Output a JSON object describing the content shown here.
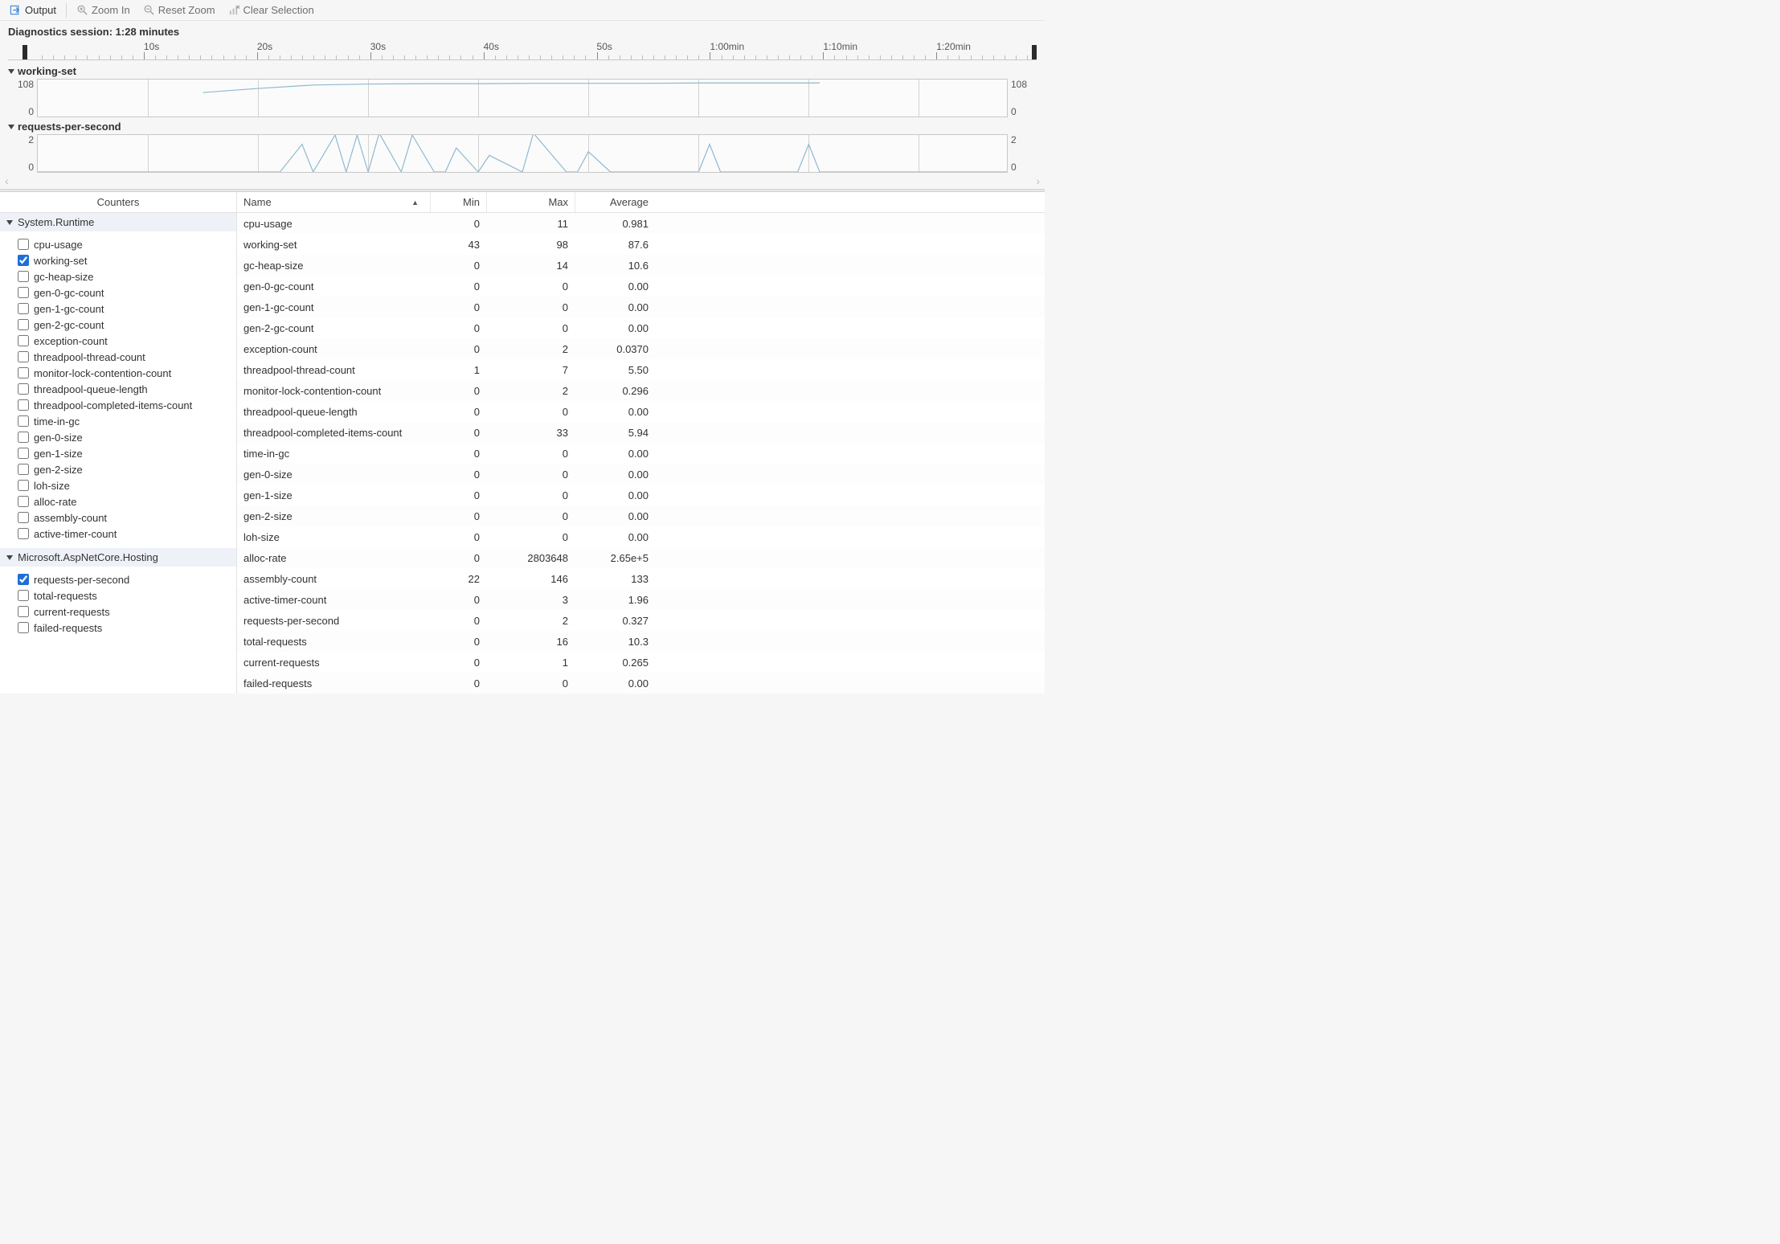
{
  "toolbar": {
    "output_label": "Output",
    "zoom_in_label": "Zoom In",
    "reset_zoom_label": "Reset Zoom",
    "clear_selection_label": "Clear Selection"
  },
  "session_label": "Diagnostics session: 1:28 minutes",
  "timeline": {
    "labels": [
      "10s",
      "20s",
      "30s",
      "40s",
      "50s",
      "1:00min",
      "1:10min",
      "1:20min"
    ]
  },
  "chart_data": [
    {
      "type": "line",
      "title": "working-set",
      "ylim": [
        0,
        108
      ],
      "yticks_left": [
        "108",
        "0"
      ],
      "yticks_right": [
        "108",
        "0"
      ],
      "x": [
        0,
        5,
        10,
        15,
        17,
        20,
        25,
        30,
        35,
        40,
        45,
        50,
        55,
        60,
        65,
        70,
        71
      ],
      "values": [
        null,
        null,
        null,
        70,
        75,
        82,
        92,
        95,
        96,
        96,
        97,
        97,
        97,
        98,
        98,
        98,
        98
      ]
    },
    {
      "type": "line",
      "title": "requests-per-second",
      "ylim": [
        0,
        2
      ],
      "yticks_left": [
        "2",
        "0"
      ],
      "yticks_right": [
        "2",
        "0"
      ],
      "x": [
        0,
        22,
        24,
        25,
        27,
        28,
        29,
        30,
        31,
        33,
        34,
        36,
        37,
        38,
        40,
        41,
        44,
        45,
        48,
        49,
        50,
        52,
        60,
        61,
        62,
        69,
        70,
        71,
        88
      ],
      "values": [
        0,
        0,
        1.5,
        0,
        2,
        0,
        2,
        0,
        2.1,
        0,
        2,
        0,
        0,
        1.3,
        0,
        0.9,
        0,
        2.1,
        0,
        0,
        1.1,
        0,
        0,
        1.5,
        0,
        0,
        1.5,
        0,
        0
      ]
    }
  ],
  "tree": {
    "header": "Counters",
    "groups": [
      {
        "label": "System.Runtime",
        "items": [
          {
            "label": "cpu-usage",
            "checked": false
          },
          {
            "label": "working-set",
            "checked": true
          },
          {
            "label": "gc-heap-size",
            "checked": false
          },
          {
            "label": "gen-0-gc-count",
            "checked": false
          },
          {
            "label": "gen-1-gc-count",
            "checked": false
          },
          {
            "label": "gen-2-gc-count",
            "checked": false
          },
          {
            "label": "exception-count",
            "checked": false
          },
          {
            "label": "threadpool-thread-count",
            "checked": false
          },
          {
            "label": "monitor-lock-contention-count",
            "checked": false
          },
          {
            "label": "threadpool-queue-length",
            "checked": false
          },
          {
            "label": "threadpool-completed-items-count",
            "checked": false
          },
          {
            "label": "time-in-gc",
            "checked": false
          },
          {
            "label": "gen-0-size",
            "checked": false
          },
          {
            "label": "gen-1-size",
            "checked": false
          },
          {
            "label": "gen-2-size",
            "checked": false
          },
          {
            "label": "loh-size",
            "checked": false
          },
          {
            "label": "alloc-rate",
            "checked": false
          },
          {
            "label": "assembly-count",
            "checked": false
          },
          {
            "label": "active-timer-count",
            "checked": false
          }
        ]
      },
      {
        "label": "Microsoft.AspNetCore.Hosting",
        "items": [
          {
            "label": "requests-per-second",
            "checked": true
          },
          {
            "label": "total-requests",
            "checked": false
          },
          {
            "label": "current-requests",
            "checked": false
          },
          {
            "label": "failed-requests",
            "checked": false
          }
        ]
      }
    ]
  },
  "table": {
    "headers": {
      "name": "Name",
      "min": "Min",
      "max": "Max",
      "avg": "Average"
    },
    "rows": [
      {
        "name": "cpu-usage",
        "min": "0",
        "max": "11",
        "avg": "0.981"
      },
      {
        "name": "working-set",
        "min": "43",
        "max": "98",
        "avg": "87.6"
      },
      {
        "name": "gc-heap-size",
        "min": "0",
        "max": "14",
        "avg": "10.6"
      },
      {
        "name": "gen-0-gc-count",
        "min": "0",
        "max": "0",
        "avg": "0.00"
      },
      {
        "name": "gen-1-gc-count",
        "min": "0",
        "max": "0",
        "avg": "0.00"
      },
      {
        "name": "gen-2-gc-count",
        "min": "0",
        "max": "0",
        "avg": "0.00"
      },
      {
        "name": "exception-count",
        "min": "0",
        "max": "2",
        "avg": "0.0370"
      },
      {
        "name": "threadpool-thread-count",
        "min": "1",
        "max": "7",
        "avg": "5.50"
      },
      {
        "name": "monitor-lock-contention-count",
        "min": "0",
        "max": "2",
        "avg": "0.296"
      },
      {
        "name": "threadpool-queue-length",
        "min": "0",
        "max": "0",
        "avg": "0.00"
      },
      {
        "name": "threadpool-completed-items-count",
        "min": "0",
        "max": "33",
        "avg": "5.94"
      },
      {
        "name": "time-in-gc",
        "min": "0",
        "max": "0",
        "avg": "0.00"
      },
      {
        "name": "gen-0-size",
        "min": "0",
        "max": "0",
        "avg": "0.00"
      },
      {
        "name": "gen-1-size",
        "min": "0",
        "max": "0",
        "avg": "0.00"
      },
      {
        "name": "gen-2-size",
        "min": "0",
        "max": "0",
        "avg": "0.00"
      },
      {
        "name": "loh-size",
        "min": "0",
        "max": "0",
        "avg": "0.00"
      },
      {
        "name": "alloc-rate",
        "min": "0",
        "max": "2803648",
        "avg": "2.65e+5"
      },
      {
        "name": "assembly-count",
        "min": "22",
        "max": "146",
        "avg": "133"
      },
      {
        "name": "active-timer-count",
        "min": "0",
        "max": "3",
        "avg": "1.96"
      },
      {
        "name": "requests-per-second",
        "min": "0",
        "max": "2",
        "avg": "0.327"
      },
      {
        "name": "total-requests",
        "min": "0",
        "max": "16",
        "avg": "10.3"
      },
      {
        "name": "current-requests",
        "min": "0",
        "max": "1",
        "avg": "0.265"
      },
      {
        "name": "failed-requests",
        "min": "0",
        "max": "0",
        "avg": "0.00"
      }
    ]
  }
}
